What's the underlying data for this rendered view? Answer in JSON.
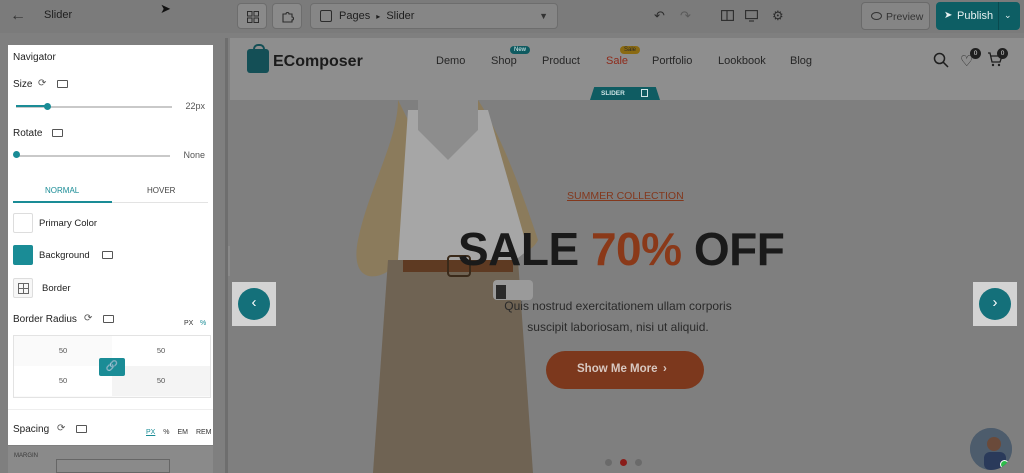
{
  "topbar": {
    "back_icon": "arrow-left-icon",
    "title": "Slider",
    "pages_label": "Pages",
    "page_current": "Slider",
    "breadcrumb_sep": "▸",
    "preview_label": "Preview",
    "publish_label": "Publish"
  },
  "panel": {
    "section_title": "Navigator",
    "size": {
      "label": "Size",
      "value": "22px",
      "level": 0.2
    },
    "rotate": {
      "label": "Rotate",
      "value": "None",
      "level": 0
    },
    "tabs": [
      {
        "label": "NORMAL",
        "active": true
      },
      {
        "label": "HOVER",
        "active": false
      }
    ],
    "primary_color": {
      "label": "Primary Color",
      "color": "#ffffff"
    },
    "background": {
      "label": "Background",
      "color": "#1a8c96"
    },
    "border": {
      "label": "Border"
    },
    "border_radius": {
      "label": "Border Radius",
      "unit_px": "PX",
      "unit_pct": "%",
      "values": [
        "50",
        "50",
        "50",
        "50"
      ]
    },
    "spacing": {
      "label": "Spacing",
      "units": [
        "PX",
        "%",
        "EM",
        "REM"
      ],
      "margin_label": "MARGIN"
    }
  },
  "site": {
    "logo": "EComposer",
    "nav": [
      {
        "label": "Demo"
      },
      {
        "label": "Shop",
        "badge": "New"
      },
      {
        "label": "Product"
      },
      {
        "label": "Sale",
        "badge": "Sale"
      },
      {
        "label": "Portfolio"
      },
      {
        "label": "Lookbook"
      },
      {
        "label": "Blog"
      }
    ],
    "wishlist_count": "0",
    "cart_count": "0",
    "slider_tag": "SLIDER"
  },
  "hero": {
    "collection": "SUMMER COLLECTION",
    "headline_pre": "SALE ",
    "headline_pct": "70%",
    "headline_post": " OFF",
    "sub_line1": "Quis nostrud exercitationem ullam corporis",
    "sub_line2": "suscipit laboriosam, nisi ut aliquid.",
    "cta": "Show Me More",
    "prev_icon": "chevron-left-icon",
    "next_icon": "chevron-right-icon",
    "active_dot": 1
  },
  "colors": {
    "accent": "#1a8c96",
    "publish": "#0d5e64",
    "sale_orange": "#8a3919"
  }
}
